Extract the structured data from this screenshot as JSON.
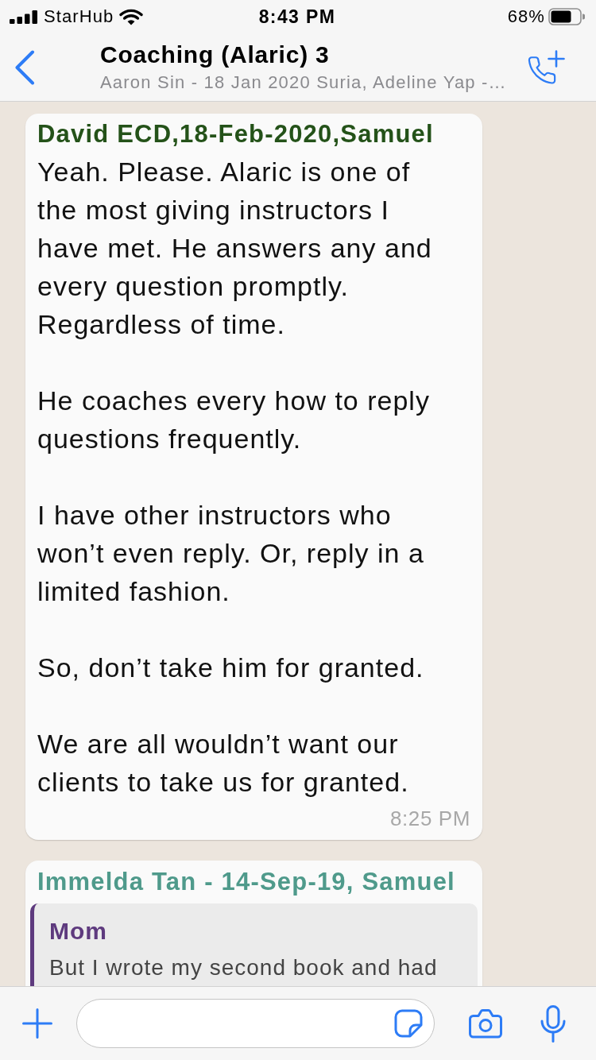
{
  "status_bar": {
    "carrier": "StarHub",
    "time": "8:43 PM",
    "battery": "68%"
  },
  "header": {
    "title": "Coaching (Alaric) 3",
    "subtitle": "Aaron Sin - 18 Jan 2020 Suria, Adeline Yap -…"
  },
  "messages": [
    {
      "kind": "text",
      "sender": "David ECD,18-Feb-2020,Samuel",
      "color": "#245219",
      "paragraphs": [
        "Yeah. Please. Alaric is one of the most giving instructors I have met. He answers any and every question promptly. Regardless of time.",
        "He coaches every how to reply questions frequently.",
        "I have other instructors who won’t even reply. Or, reply in a limited fashion.",
        "So, don’t take him for granted.",
        "We are all wouldn’t want our clients to take us for granted."
      ],
      "time": "8:25 PM"
    },
    {
      "kind": "reply",
      "sender": "Immelda Tan - 14-Sep-19, Samuel",
      "color": "#4f9a8b",
      "quote": {
        "author": "Mom",
        "color": "#5e3a7e",
        "text": "But I wrote my second book and had"
      }
    }
  ]
}
